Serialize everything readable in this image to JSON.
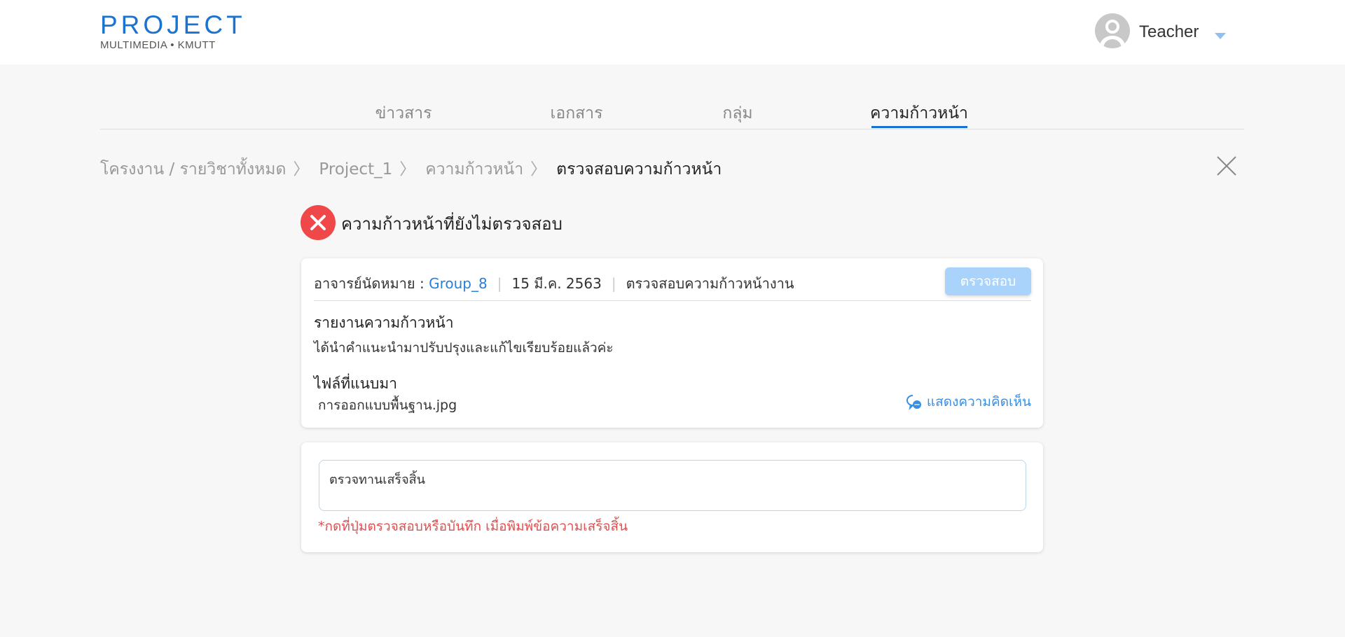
{
  "header": {
    "logo_main": "PROJECT",
    "logo_sub": "MULTIMEDIA • KMUTT",
    "user_name": "Teacher"
  },
  "tabs": [
    {
      "label": "ข่าวสาร"
    },
    {
      "label": "เอกสาร"
    },
    {
      "label": "กลุ่ม"
    },
    {
      "label": "ความก้าวหน้า",
      "active": true
    }
  ],
  "breadcrumb": {
    "items": [
      "โครงงาน / รายวิชาทั้งหมด",
      "Project_1",
      "ความก้าวหน้า"
    ],
    "current": "ตรวจสอบความก้าวหน้า"
  },
  "status": {
    "icon": "x-circle-icon",
    "title": "ความก้าวหน้าที่ยังไม่ตรวจสอบ",
    "color": "#f04848"
  },
  "card": {
    "appointment_label": "อาจารย์นัดหมาย :",
    "group": "Group_8",
    "date": "15 มี.ค. 2563",
    "topic": "ตรวจสอบความก้าวหน้างาน",
    "check_button": "ตรวจสอบ",
    "report_label": "รายงานความก้าวหน้า",
    "report_text": "ได้นำคำแนะนำมาปรับปรุงและแก้ไขเรียบร้อยแล้วค่ะ",
    "files_label": "ไฟล์ที่แนบมา",
    "file_name": "การออกแบบพื้นฐาน.jpg",
    "comment_link": "แสดงความคิดเห็น"
  },
  "review": {
    "value": "ตรวจทานเสร็จสิ้น",
    "hint": "*กดที่ปุ่มตรวจสอบหรือบันทึก เมื่อพิมพ์ข้อความเสร็จสิ้น"
  },
  "colors": {
    "accent": "#1a6fd0",
    "link": "#2a7fd6",
    "button_disabled": "#a9d3fb",
    "error": "#e05050"
  }
}
